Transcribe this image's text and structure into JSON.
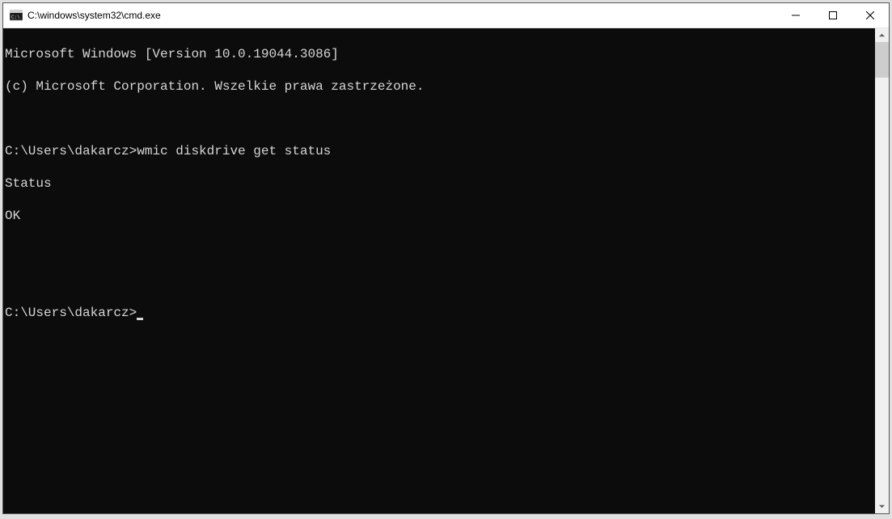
{
  "window": {
    "title": "C:\\windows\\system32\\cmd.exe"
  },
  "console": {
    "header1": "Microsoft Windows [Version 10.0.19044.3086]",
    "header2": "(c) Microsoft Corporation. Wszelkie prawa zastrzeżone.",
    "blank": "",
    "prompt1": "C:\\Users\\dakarcz>",
    "command1": "wmic diskdrive get status",
    "output_header": "Status",
    "output_value": "OK",
    "prompt2": "C:\\Users\\dakarcz>"
  }
}
